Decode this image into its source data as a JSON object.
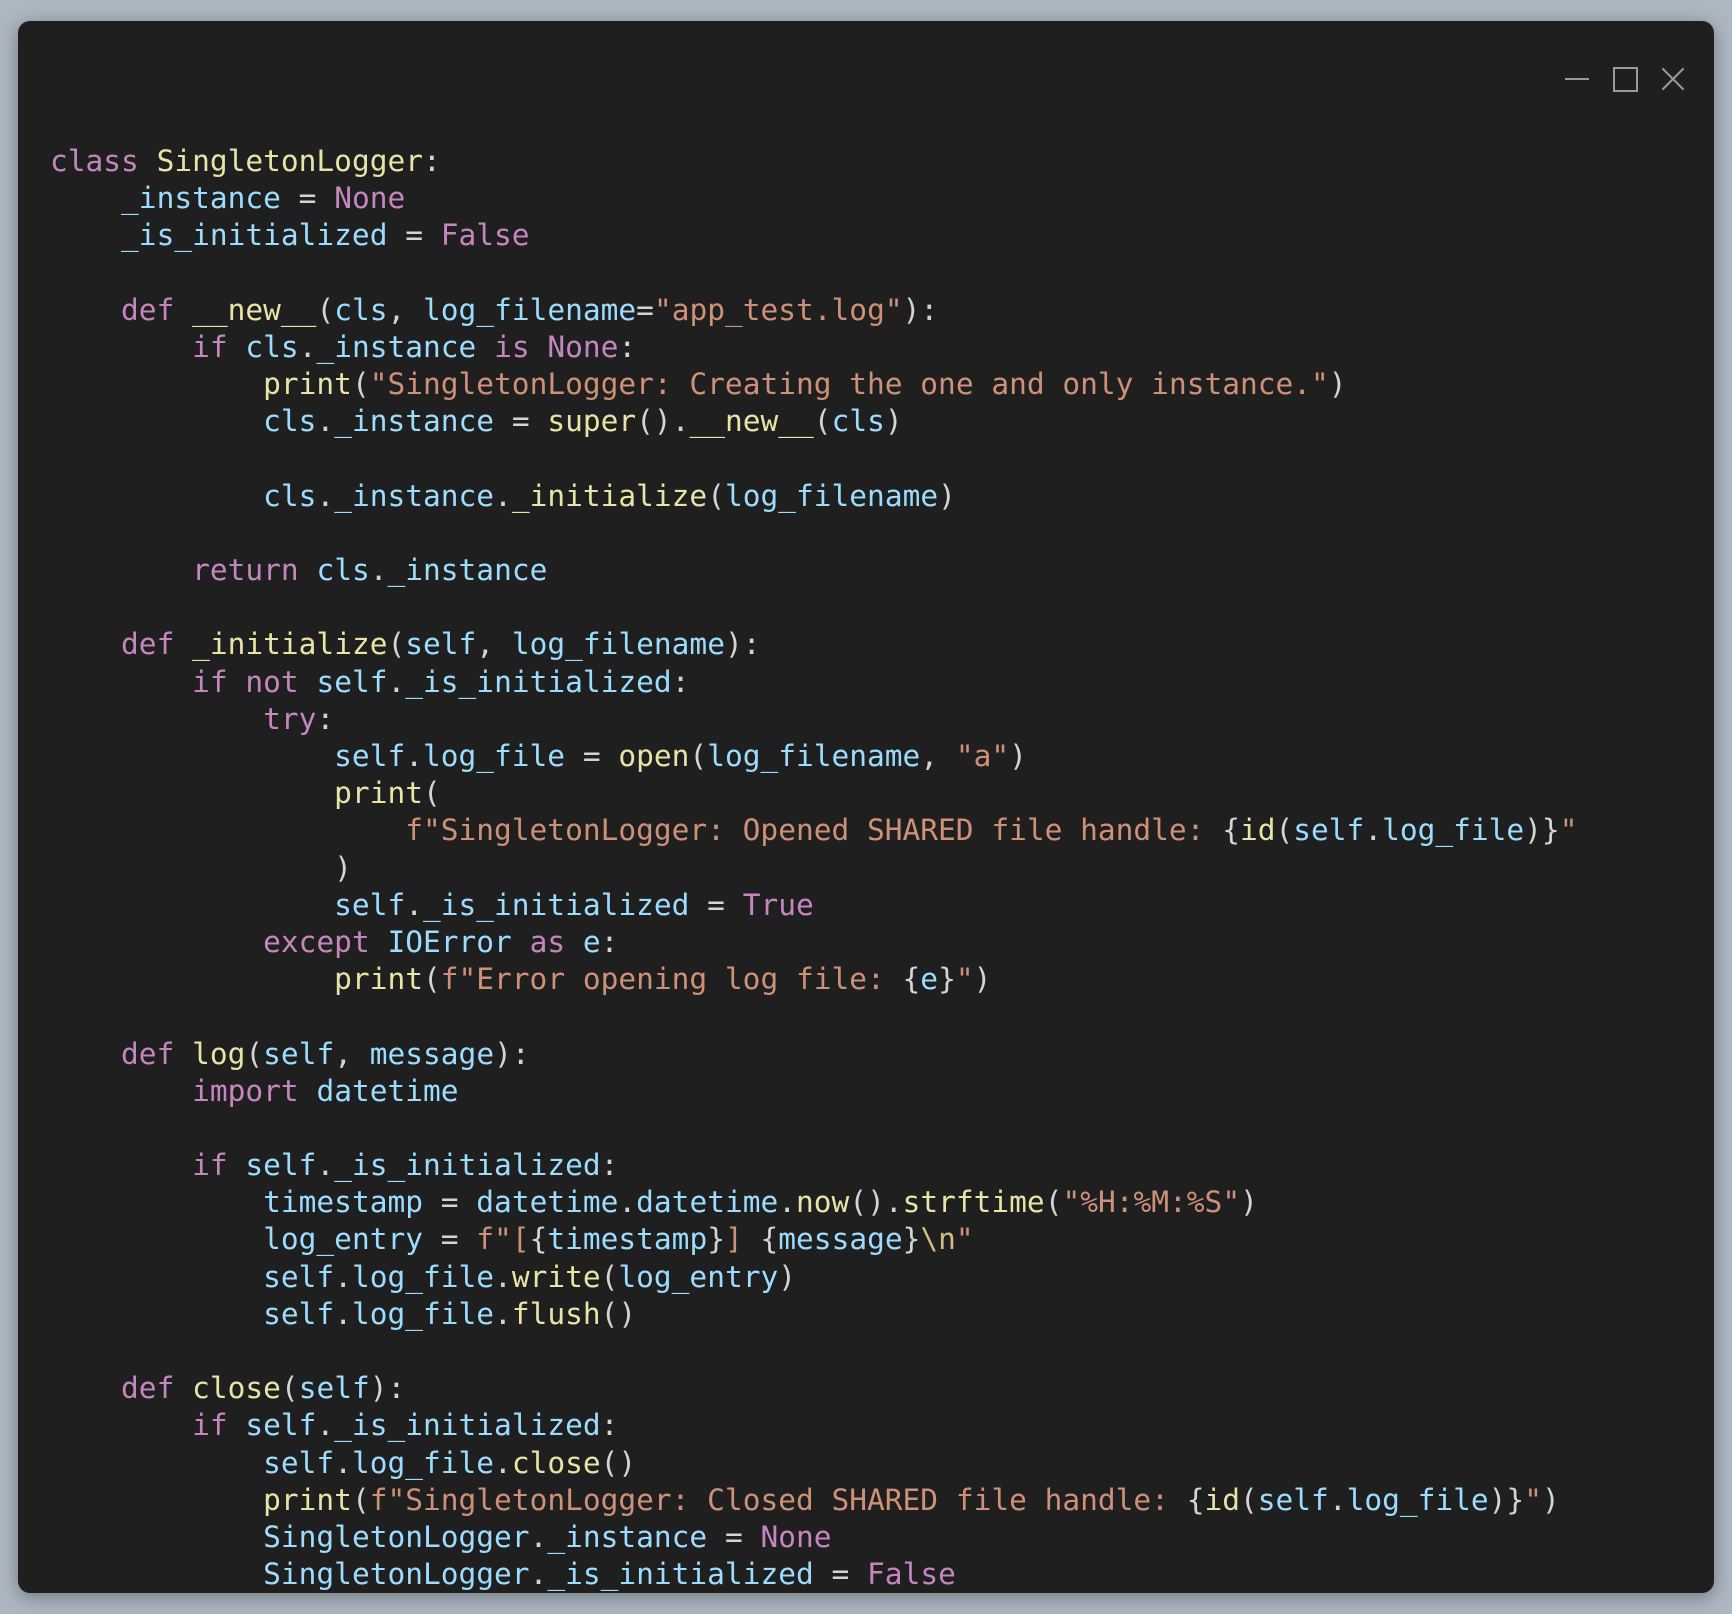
{
  "window": {
    "controls": [
      "minimize",
      "maximize",
      "close"
    ]
  },
  "colors": {
    "background": "#1f1f1f",
    "page_background": "#adb7c2",
    "keyword": "#c586c0",
    "function": "#e8e3a6",
    "variable": "#9cdcfe",
    "string": "#ce9178",
    "plain": "#d4d4d4"
  },
  "code": {
    "language": "python",
    "lines": [
      [
        [
          "kw",
          "class"
        ],
        [
          "op",
          " "
        ],
        [
          "cls",
          "SingletonLogger"
        ],
        [
          "op",
          ":"
        ]
      ],
      [
        [
          "op",
          "    "
        ],
        [
          "var",
          "_instance"
        ],
        [
          "op",
          " = "
        ],
        [
          "kw",
          "None"
        ]
      ],
      [
        [
          "op",
          "    "
        ],
        [
          "var",
          "_is_initialized"
        ],
        [
          "op",
          " = "
        ],
        [
          "kw",
          "False"
        ]
      ],
      [],
      [
        [
          "op",
          "    "
        ],
        [
          "kw",
          "def"
        ],
        [
          "op",
          " "
        ],
        [
          "fn",
          "__new__"
        ],
        [
          "op",
          "("
        ],
        [
          "var",
          "cls"
        ],
        [
          "op",
          ", "
        ],
        [
          "var",
          "log_filename"
        ],
        [
          "op",
          "="
        ],
        [
          "str",
          "\"app_test.log\""
        ],
        [
          "op",
          "):"
        ]
      ],
      [
        [
          "op",
          "        "
        ],
        [
          "kw",
          "if"
        ],
        [
          "op",
          " "
        ],
        [
          "var",
          "cls"
        ],
        [
          "op",
          "."
        ],
        [
          "var",
          "_instance"
        ],
        [
          "op",
          " "
        ],
        [
          "kw",
          "is"
        ],
        [
          "op",
          " "
        ],
        [
          "kw",
          "None"
        ],
        [
          "op",
          ":"
        ]
      ],
      [
        [
          "op",
          "            "
        ],
        [
          "fn",
          "print"
        ],
        [
          "op",
          "("
        ],
        [
          "str",
          "\"SingletonLogger: Creating the one and only instance.\""
        ],
        [
          "op",
          ")"
        ]
      ],
      [
        [
          "op",
          "            "
        ],
        [
          "var",
          "cls"
        ],
        [
          "op",
          "."
        ],
        [
          "var",
          "_instance"
        ],
        [
          "op",
          " = "
        ],
        [
          "fn",
          "super"
        ],
        [
          "op",
          "()."
        ],
        [
          "fn",
          "__new__"
        ],
        [
          "op",
          "("
        ],
        [
          "var",
          "cls"
        ],
        [
          "op",
          ")"
        ]
      ],
      [],
      [
        [
          "op",
          "            "
        ],
        [
          "var",
          "cls"
        ],
        [
          "op",
          "."
        ],
        [
          "var",
          "_instance"
        ],
        [
          "op",
          "."
        ],
        [
          "fn",
          "_initialize"
        ],
        [
          "op",
          "("
        ],
        [
          "var",
          "log_filename"
        ],
        [
          "op",
          ")"
        ]
      ],
      [],
      [
        [
          "op",
          "        "
        ],
        [
          "kw",
          "return"
        ],
        [
          "op",
          " "
        ],
        [
          "var",
          "cls"
        ],
        [
          "op",
          "."
        ],
        [
          "var",
          "_instance"
        ]
      ],
      [],
      [
        [
          "op",
          "    "
        ],
        [
          "kw",
          "def"
        ],
        [
          "op",
          " "
        ],
        [
          "fn",
          "_initialize"
        ],
        [
          "op",
          "("
        ],
        [
          "var",
          "self"
        ],
        [
          "op",
          ", "
        ],
        [
          "var",
          "log_filename"
        ],
        [
          "op",
          "):"
        ]
      ],
      [
        [
          "op",
          "        "
        ],
        [
          "kw",
          "if"
        ],
        [
          "op",
          " "
        ],
        [
          "kw",
          "not"
        ],
        [
          "op",
          " "
        ],
        [
          "var",
          "self"
        ],
        [
          "op",
          "."
        ],
        [
          "var",
          "_is_initialized"
        ],
        [
          "op",
          ":"
        ]
      ],
      [
        [
          "op",
          "            "
        ],
        [
          "kw",
          "try"
        ],
        [
          "op",
          ":"
        ]
      ],
      [
        [
          "op",
          "                "
        ],
        [
          "var",
          "self"
        ],
        [
          "op",
          "."
        ],
        [
          "var",
          "log_file"
        ],
        [
          "op",
          " = "
        ],
        [
          "fn",
          "open"
        ],
        [
          "op",
          "("
        ],
        [
          "var",
          "log_filename"
        ],
        [
          "op",
          ", "
        ],
        [
          "str",
          "\"a\""
        ],
        [
          "op",
          ")"
        ]
      ],
      [
        [
          "op",
          "                "
        ],
        [
          "fn",
          "print"
        ],
        [
          "op",
          "("
        ]
      ],
      [
        [
          "op",
          "                    "
        ],
        [
          "str",
          "f\"SingletonLogger: Opened SHARED file handle: "
        ],
        [
          "op",
          "{"
        ],
        [
          "fn",
          "id"
        ],
        [
          "op",
          "("
        ],
        [
          "var",
          "self"
        ],
        [
          "op",
          "."
        ],
        [
          "var",
          "log_file"
        ],
        [
          "op",
          ")}"
        ],
        [
          "str",
          "\""
        ]
      ],
      [
        [
          "op",
          "                )"
        ]
      ],
      [
        [
          "op",
          "                "
        ],
        [
          "var",
          "self"
        ],
        [
          "op",
          "."
        ],
        [
          "var",
          "_is_initialized"
        ],
        [
          "op",
          " = "
        ],
        [
          "kw",
          "True"
        ]
      ],
      [
        [
          "op",
          "            "
        ],
        [
          "kw",
          "except"
        ],
        [
          "op",
          " "
        ],
        [
          "var",
          "IOError"
        ],
        [
          "op",
          " "
        ],
        [
          "kw",
          "as"
        ],
        [
          "op",
          " "
        ],
        [
          "var",
          "e"
        ],
        [
          "op",
          ":"
        ]
      ],
      [
        [
          "op",
          "                "
        ],
        [
          "fn",
          "print"
        ],
        [
          "op",
          "("
        ],
        [
          "str",
          "f\"Error opening log file: "
        ],
        [
          "op",
          "{"
        ],
        [
          "var",
          "e"
        ],
        [
          "op",
          "}"
        ],
        [
          "str",
          "\""
        ],
        [
          "op",
          ")"
        ]
      ],
      [],
      [
        [
          "op",
          "    "
        ],
        [
          "kw",
          "def"
        ],
        [
          "op",
          " "
        ],
        [
          "fn",
          "log"
        ],
        [
          "op",
          "("
        ],
        [
          "var",
          "self"
        ],
        [
          "op",
          ", "
        ],
        [
          "var",
          "message"
        ],
        [
          "op",
          "):"
        ]
      ],
      [
        [
          "op",
          "        "
        ],
        [
          "kw",
          "import"
        ],
        [
          "op",
          " "
        ],
        [
          "var",
          "datetime"
        ]
      ],
      [],
      [
        [
          "op",
          "        "
        ],
        [
          "kw",
          "if"
        ],
        [
          "op",
          " "
        ],
        [
          "var",
          "self"
        ],
        [
          "op",
          "."
        ],
        [
          "var",
          "_is_initialized"
        ],
        [
          "op",
          ":"
        ]
      ],
      [
        [
          "op",
          "            "
        ],
        [
          "var",
          "timestamp"
        ],
        [
          "op",
          " = "
        ],
        [
          "var",
          "datetime"
        ],
        [
          "op",
          "."
        ],
        [
          "var",
          "datetime"
        ],
        [
          "op",
          "."
        ],
        [
          "fn",
          "now"
        ],
        [
          "op",
          "()."
        ],
        [
          "fn",
          "strftime"
        ],
        [
          "op",
          "("
        ],
        [
          "str",
          "\"%H:%M:%S\""
        ],
        [
          "op",
          ")"
        ]
      ],
      [
        [
          "op",
          "            "
        ],
        [
          "var",
          "log_entry"
        ],
        [
          "op",
          " = "
        ],
        [
          "str",
          "f\"["
        ],
        [
          "op",
          "{"
        ],
        [
          "var",
          "timestamp"
        ],
        [
          "op",
          "}"
        ],
        [
          "str",
          "] "
        ],
        [
          "op",
          "{"
        ],
        [
          "var",
          "message"
        ],
        [
          "op",
          "}"
        ],
        [
          "esc",
          "\\n"
        ],
        [
          "str",
          "\""
        ]
      ],
      [
        [
          "op",
          "            "
        ],
        [
          "var",
          "self"
        ],
        [
          "op",
          "."
        ],
        [
          "var",
          "log_file"
        ],
        [
          "op",
          "."
        ],
        [
          "fn",
          "write"
        ],
        [
          "op",
          "("
        ],
        [
          "var",
          "log_entry"
        ],
        [
          "op",
          ")"
        ]
      ],
      [
        [
          "op",
          "            "
        ],
        [
          "var",
          "self"
        ],
        [
          "op",
          "."
        ],
        [
          "var",
          "log_file"
        ],
        [
          "op",
          "."
        ],
        [
          "fn",
          "flush"
        ],
        [
          "op",
          "()"
        ]
      ],
      [],
      [
        [
          "op",
          "    "
        ],
        [
          "kw",
          "def"
        ],
        [
          "op",
          " "
        ],
        [
          "fn",
          "close"
        ],
        [
          "op",
          "("
        ],
        [
          "var",
          "self"
        ],
        [
          "op",
          "):"
        ]
      ],
      [
        [
          "op",
          "        "
        ],
        [
          "kw",
          "if"
        ],
        [
          "op",
          " "
        ],
        [
          "var",
          "self"
        ],
        [
          "op",
          "."
        ],
        [
          "var",
          "_is_initialized"
        ],
        [
          "op",
          ":"
        ]
      ],
      [
        [
          "op",
          "            "
        ],
        [
          "var",
          "self"
        ],
        [
          "op",
          "."
        ],
        [
          "var",
          "log_file"
        ],
        [
          "op",
          "."
        ],
        [
          "fn",
          "close"
        ],
        [
          "op",
          "()"
        ]
      ],
      [
        [
          "op",
          "            "
        ],
        [
          "fn",
          "print"
        ],
        [
          "op",
          "("
        ],
        [
          "str",
          "f\"SingletonLogger: Closed SHARED file handle: "
        ],
        [
          "op",
          "{"
        ],
        [
          "fn",
          "id"
        ],
        [
          "op",
          "("
        ],
        [
          "var",
          "self"
        ],
        [
          "op",
          "."
        ],
        [
          "var",
          "log_file"
        ],
        [
          "op",
          ")}"
        ],
        [
          "str",
          "\""
        ],
        [
          "op",
          ")"
        ]
      ],
      [
        [
          "op",
          "            "
        ],
        [
          "var",
          "SingletonLogger"
        ],
        [
          "op",
          "."
        ],
        [
          "var",
          "_instance"
        ],
        [
          "op",
          " = "
        ],
        [
          "kw",
          "None"
        ]
      ],
      [
        [
          "op",
          "            "
        ],
        [
          "var",
          "SingletonLogger"
        ],
        [
          "op",
          "."
        ],
        [
          "var",
          "_is_initialized"
        ],
        [
          "op",
          " = "
        ],
        [
          "kw",
          "False"
        ]
      ]
    ]
  }
}
